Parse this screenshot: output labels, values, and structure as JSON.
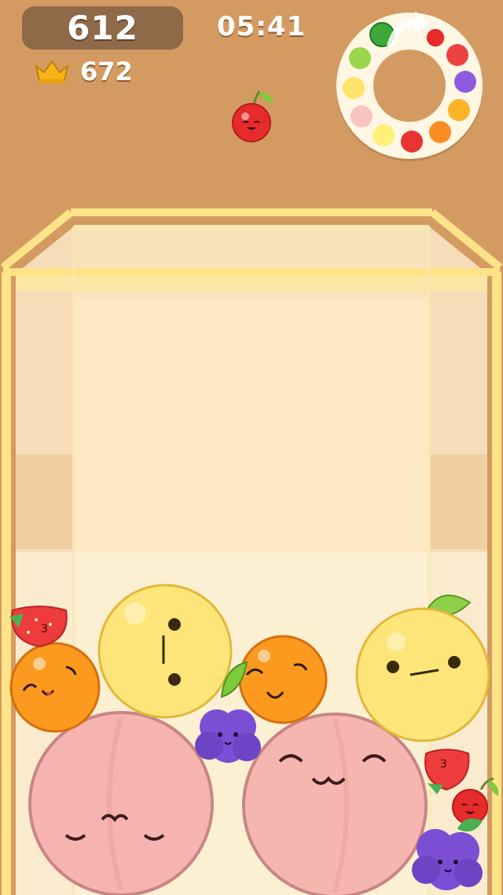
{
  "hud": {
    "score": "612",
    "timer": "05:41",
    "best_score": "672"
  },
  "icons": {
    "best": "crown-icon",
    "cycle": "cycle-arrow-icon"
  },
  "evolution_wheel": [
    "cherry",
    "strawberry",
    "grape",
    "orange",
    "persimmon",
    "apple",
    "lemon",
    "peach",
    "pineapple",
    "melon",
    "watermelon"
  ],
  "next_fruit": "cherry",
  "colors": {
    "background": "#d39b61",
    "score_box": "#8f6a49",
    "container_frame": "#ffe28a",
    "peach": "#f5b4b0",
    "lemon": "#fde57a",
    "orange": "#fb9a1f",
    "grape": "#7b4fd3",
    "strawberry": "#ee3b3b",
    "cherry": "#e82c2c"
  }
}
